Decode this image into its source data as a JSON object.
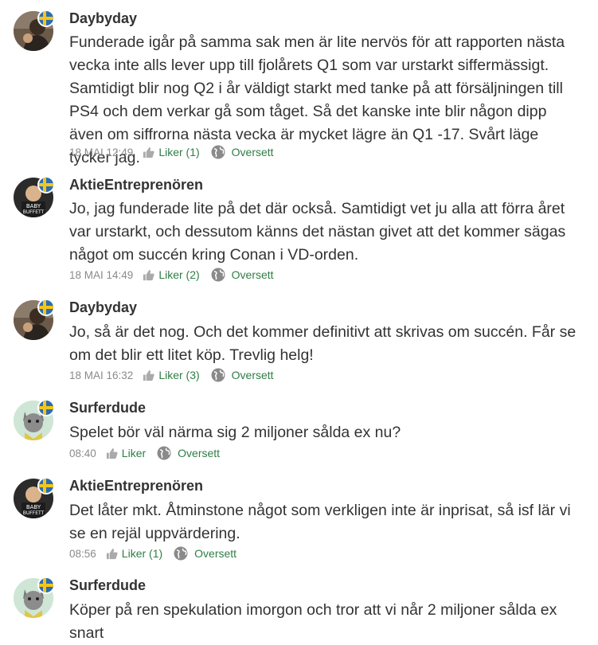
{
  "comments": [
    {
      "author": "Daybyday",
      "avatar": "daybyday-avatar",
      "text": "Funderade igår på samma sak men är lite nervös för att rapporten nästa vecka inte alls lever upp till fjolårets Q1 som var urstarkt siffermässigt. Samtidigt blir nog Q2 i år väldigt starkt med tanke på att försäljningen till PS4 och dem verkar gå som tåget. Så det kanske inte blir någon dipp även om siffrorna nästa vecka är mycket lägre än Q1 -17. Svårt läge tycker jag.",
      "timestamp": "18 MAI 12:49",
      "likes": "Liker (1)",
      "translate": "Oversett"
    },
    {
      "author": "AktieEntreprenören",
      "avatar": "aktieentreprenoren-avatar",
      "text": "Jo, jag funderade lite på det där också. Samtidigt vet ju alla att förra året var urstarkt, och dessutom känns det nästan givet att det kommer sägas något om succén kring Conan i VD-orden.",
      "timestamp": "18 MAI 14:49",
      "likes": "Liker (2)",
      "translate": "Oversett"
    },
    {
      "author": "Daybyday",
      "avatar": "daybyday-avatar",
      "text": "Jo, så är det nog. Och det kommer definitivt att skrivas om succén. Får se om det blir ett litet köp. Trevlig helg!",
      "timestamp": "18 MAI 16:32",
      "likes": "Liker (3)",
      "translate": "Oversett"
    },
    {
      "author": "Surferdude",
      "avatar": "surferdude-avatar",
      "text": "Spelet bör väl närma sig 2 miljoner sålda ex nu?",
      "timestamp": "08:40",
      "likes": "Liker",
      "translate": "Oversett"
    },
    {
      "author": "AktieEntreprenören",
      "avatar": "aktieentreprenoren-avatar",
      "text": "Det låter mkt. Åtminstone något som verkligen inte är inprisat, så isf lär vi se en rejäl uppvärdering.",
      "timestamp": "08:56",
      "likes": "Liker (1)",
      "translate": "Oversett"
    },
    {
      "author": "Surferdude",
      "avatar": "surferdude-avatar",
      "text": "Köper på ren spekulation imorgon och tror att vi når 2 miljoner sålda ex snart",
      "timestamp": "",
      "likes": "",
      "translate": ""
    }
  ],
  "colors": {
    "accent": "#2f7d45",
    "meta_text": "#8a8a8a",
    "flag_blue": "#2b6db3",
    "flag_yellow": "#f5c518"
  },
  "icons": {
    "like": "thumbs-up-icon",
    "translate": "globe-icon",
    "country": "sweden-flag-icon"
  }
}
